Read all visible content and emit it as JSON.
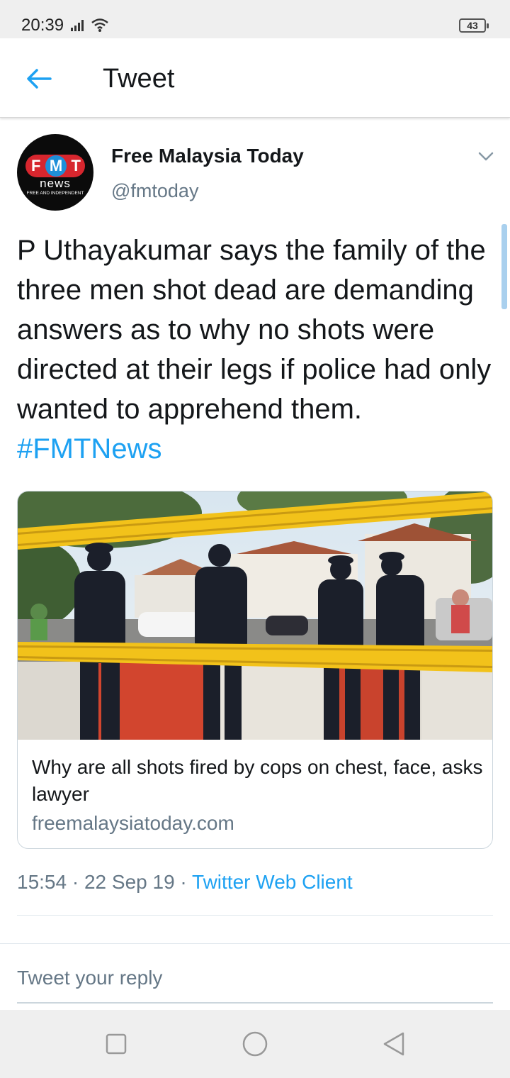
{
  "status_bar": {
    "time": "20:39",
    "battery": "43"
  },
  "header": {
    "title": "Tweet"
  },
  "tweet": {
    "author_name": "Free Malaysia Today",
    "author_handle": "@fmtoday",
    "avatar": {
      "letters": [
        "F",
        "M",
        "T"
      ],
      "word": "news",
      "tagline": "FREE AND INDEPENDENT"
    },
    "text": "P Uthayakumar says the family of the three men shot dead are demanding answers as to why no shots were directed at their legs if police had only wanted to apprehend them.",
    "hashtag": "#FMTNews",
    "card": {
      "image_icon": "police-tape-photo",
      "title": "Why are all shots fired by cops on chest, face, asks lawyer",
      "domain": "freemalaysiatoday.com"
    },
    "time": "15:54",
    "date": "22 Sep 19",
    "separator": "·",
    "client": "Twitter Web Client"
  },
  "reply": {
    "placeholder": "Tweet your reply"
  },
  "colors": {
    "accent": "#1da1f2",
    "secondary_text": "#657786",
    "tape_yellow": "#f2c21a"
  }
}
